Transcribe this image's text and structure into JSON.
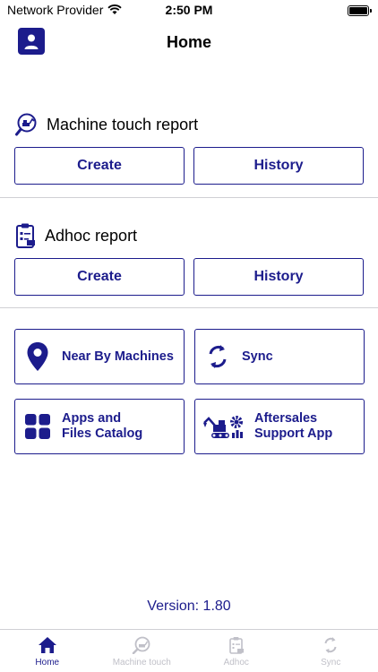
{
  "status_bar": {
    "carrier": "Network Provider",
    "time": "2:50 PM"
  },
  "header": {
    "title": "Home",
    "avatar_icon": "person-icon"
  },
  "machine_touch_report": {
    "title": "Machine touch report",
    "icon": "machine-search-icon",
    "create_label": "Create",
    "history_label": "History"
  },
  "adhoc_report": {
    "title": "Adhoc report",
    "icon": "clipboard-icon",
    "create_label": "Create",
    "history_label": "History"
  },
  "tiles": {
    "near_by": {
      "label": "Near By Machines",
      "icon": "location-pin-icon"
    },
    "sync": {
      "label": "Sync",
      "icon": "sync-icon"
    },
    "apps_catalog": {
      "label": "Apps and\nFiles Catalog",
      "icon": "grid-icon"
    },
    "aftersales": {
      "label": "Aftersales\nSupport App",
      "icon": "excavator-gear-icon"
    }
  },
  "version": "Version: 1.80",
  "tab_bar": {
    "items": [
      {
        "label": "Home",
        "icon": "home-icon",
        "active": true
      },
      {
        "label": "Machine touch",
        "icon": "machine-search-icon",
        "active": false
      },
      {
        "label": "Adhoc",
        "icon": "clipboard-icon",
        "active": false
      },
      {
        "label": "Sync",
        "icon": "sync-icon",
        "active": false
      }
    ]
  },
  "colors": {
    "primary": "#1c1c8c",
    "divider": "#d0d0d4",
    "inactive_tab": "#c0c0c8"
  }
}
